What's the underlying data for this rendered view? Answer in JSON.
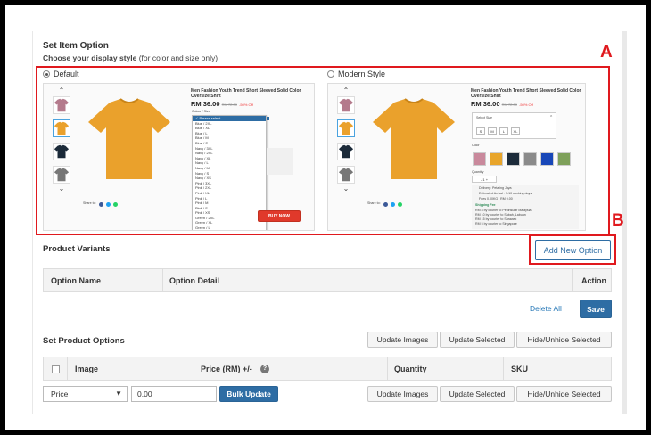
{
  "section": {
    "title": "Set Item Option",
    "subtitle_bold": "Choose your display style",
    "subtitle_rest": " (for color and size only)"
  },
  "styles": {
    "default_label": "Default",
    "modern_label": "Modern Style",
    "selected": "default"
  },
  "preview": {
    "product_title": "Men Fashion Youth Trend Short Sleeved Solid Color Oversize Shirt",
    "price": "RM 36.00",
    "old_price": "RM 72.00",
    "discount": "-50% Off",
    "share_label": "Share to:",
    "dropdown_label": "Colour / Size",
    "dropdown_options": [
      "✓ Please select",
      "Blue / 2XL",
      "Blue / XL",
      "Blue / L",
      "Blue / M",
      "Blue / S",
      "Navy / 3XL",
      "Navy / 2XL",
      "Navy / XL",
      "Navy / L",
      "Navy / M",
      "Navy / S",
      "Navy / XS",
      "Pink / 3XL",
      "Pink / 2XL",
      "Pink / XL",
      "Pink / L",
      "Pink / M",
      "Pink / S",
      "Pink / XS",
      "Green / 2XL",
      "Green / XL",
      "Green / L"
    ],
    "buy_now": "BUY NOW",
    "select_size": "Select Size",
    "sizes": [
      "S",
      "M",
      "L",
      "XL"
    ],
    "color_label": "Color",
    "swatches": [
      "#c9899c",
      "#e8a52b",
      "#1c2b3a",
      "#8a8a8a",
      "#1847b8",
      "#7ea05a"
    ],
    "quantity_label": "Quantity",
    "quantity_value": "1",
    "delivery_label": "Delivery: Petaling Jaya",
    "estimated_label": "Estimated Arrival : 7-10 working days",
    "fee_label": "Fees 0.00KG : RM 0.00",
    "shipping_fee_label": "Shipping Fee",
    "shipping_lines": [
      "RM 8 by courier to Peninsular Malaysia",
      "RM 10 by courier to Sabah, Labuan",
      "RM 15 by courier to Sarawak",
      "RM 5 by courier to Singapore"
    ]
  },
  "annotations": {
    "a": "A",
    "b": "B"
  },
  "variants": {
    "title": "Product Variants",
    "add_button": "Add New Option",
    "col_name": "Option Name",
    "col_detail": "Option Detail",
    "col_action": "Action",
    "delete_all": "Delete All",
    "save": "Save"
  },
  "options": {
    "title": "Set Product Options",
    "update_images": "Update Images",
    "update_selected": "Update Selected",
    "hide_unhide": "Hide/Unhide Selected",
    "col_image": "Image",
    "col_price": "Price (RM) +/-",
    "col_quantity": "Quantity",
    "col_sku": "SKU",
    "bulk_select": "Price",
    "bulk_value": "0.00",
    "bulk_update": "Bulk Update"
  },
  "colors": {
    "annotation_red": "#e0191e",
    "primary_blue": "#2e6da4",
    "tshirt_orange": "#eaa12c",
    "buy_now_red": "#e0392b"
  }
}
